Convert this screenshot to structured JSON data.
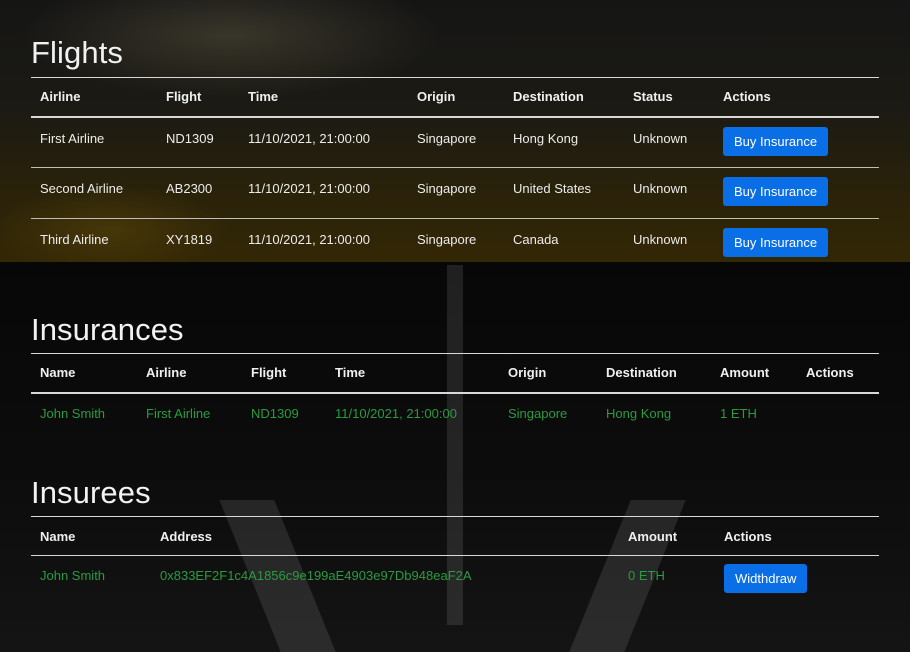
{
  "flights": {
    "title": "Flights",
    "columns": [
      "Airline",
      "Flight",
      "Time",
      "Origin",
      "Destination",
      "Status",
      "Actions"
    ],
    "rows": [
      {
        "airline": "First Airline",
        "flight": "ND1309",
        "time": "11/10/2021, 21:00:00",
        "origin": "Singapore",
        "destination": "Hong Kong",
        "status": "Unknown",
        "action": "Buy Insurance"
      },
      {
        "airline": "Second Airline",
        "flight": "AB2300",
        "time": "11/10/2021, 21:00:00",
        "origin": "Singapore",
        "destination": "United States",
        "status": "Unknown",
        "action": "Buy Insurance"
      },
      {
        "airline": "Third Airline",
        "flight": "XY1819",
        "time": "11/10/2021, 21:00:00",
        "origin": "Singapore",
        "destination": "Canada",
        "status": "Unknown",
        "action": "Buy Insurance"
      }
    ]
  },
  "insurances": {
    "title": "Insurances",
    "columns": [
      "Name",
      "Airline",
      "Flight",
      "Time",
      "Origin",
      "Destination",
      "Amount",
      "Actions"
    ],
    "rows": [
      {
        "name": "John Smith",
        "airline": "First Airline",
        "flight": "ND1309",
        "time": "11/10/2021, 21:00:00",
        "origin": "Singapore",
        "destination": "Hong Kong",
        "amount": "1 ETH"
      }
    ]
  },
  "insurees": {
    "title": "Insurees",
    "columns": [
      "Name",
      "Address",
      "Amount",
      "Actions"
    ],
    "rows": [
      {
        "name": "John Smith",
        "address": "0x833EF2F1c4A1856c9e199aE4903e97Db948eaF2A",
        "amount": "0 ETH",
        "action": "Widthdraw"
      }
    ]
  },
  "colors": {
    "accent_button": "#0a6fe6",
    "positive_text": "#2a9b3f",
    "background": "#070707"
  }
}
